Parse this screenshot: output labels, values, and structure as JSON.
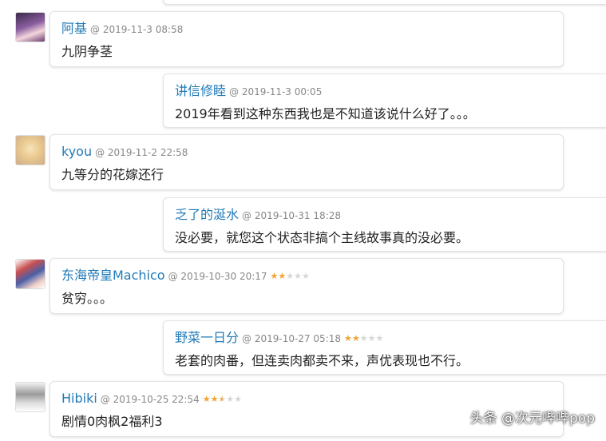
{
  "comments": [
    {
      "name": "阿基",
      "date": "@ 2019-11-3 08:58",
      "text": "九阴争茎",
      "stars": 0
    },
    {
      "name": "讲信修睦",
      "date": "@ 2019-11-3 00:05",
      "text": "2019年看到这种东西我也是不知道该说什么好了。。。",
      "stars": 0
    },
    {
      "name": "kyou",
      "date": "@ 2019-11-2 22:58",
      "text": "九等分的花嫁还行",
      "stars": 0
    },
    {
      "name": "乏了的涎水",
      "date": "@ 2019-10-31 18:28",
      "text": "没必要，就您这个状态非搞个主线故事真的没必要。",
      "stars": 0
    },
    {
      "name": "东海帝皇Machico",
      "date": "@ 2019-10-30 20:17",
      "text": "贫穷。。。",
      "stars": 2
    },
    {
      "name": "野菜一日分",
      "date": "@ 2019-10-27 05:18",
      "text": "老套的肉番，但连卖肉都卖不来，声优表现也不行。",
      "stars": 2
    },
    {
      "name": "Hibiki",
      "date": "@ 2019-10-25 22:54",
      "text": "剧情0肉枫2福利3",
      "stars": 2.5
    }
  ],
  "watermark": "头条 @次元哔哔pop",
  "colors": {
    "accent": "#1f7ab8",
    "star": "#f0a430"
  }
}
